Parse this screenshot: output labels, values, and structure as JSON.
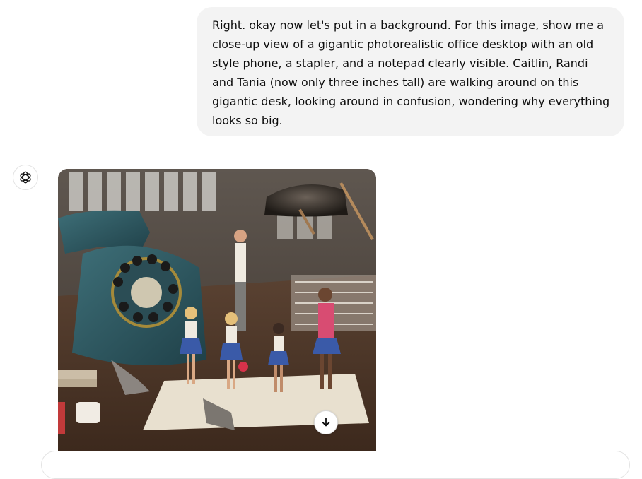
{
  "conversation": {
    "user_message": "Right. okay now let's put in a background. For this image, show me a close-up view of a gigantic photorealistic office desktop with an old style phone, a stapler, and a notepad clearly visible. Caitlin, Randi and Tania (now only three inches tall) are walking around on this gigantic desk, looking around in confusion, wondering why everything looks so big.",
    "assistant_avatar_icon": "openai-logo-icon",
    "generated_image_icon": "download-icon"
  }
}
